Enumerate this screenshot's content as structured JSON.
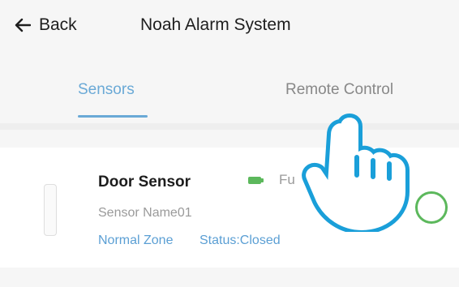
{
  "header": {
    "back_label": "Back",
    "title": "Noah Alarm System"
  },
  "tabs": [
    {
      "label": "Sensors",
      "active": true
    },
    {
      "label": "Remote Control",
      "active": false
    }
  ],
  "sensor": {
    "name": "Door Sensor",
    "battery_text": "Fu",
    "subname": "Sensor Name01",
    "zone": "Normal Zone",
    "status": "Status:Closed"
  },
  "colors": {
    "accent": "#6aa9d6",
    "battery": "#5cb85c",
    "hand_outline": "#1a9fd9"
  },
  "icons": [
    "back-arrow-icon",
    "battery-icon",
    "door-sensor-icon",
    "pointing-hand-icon"
  ]
}
